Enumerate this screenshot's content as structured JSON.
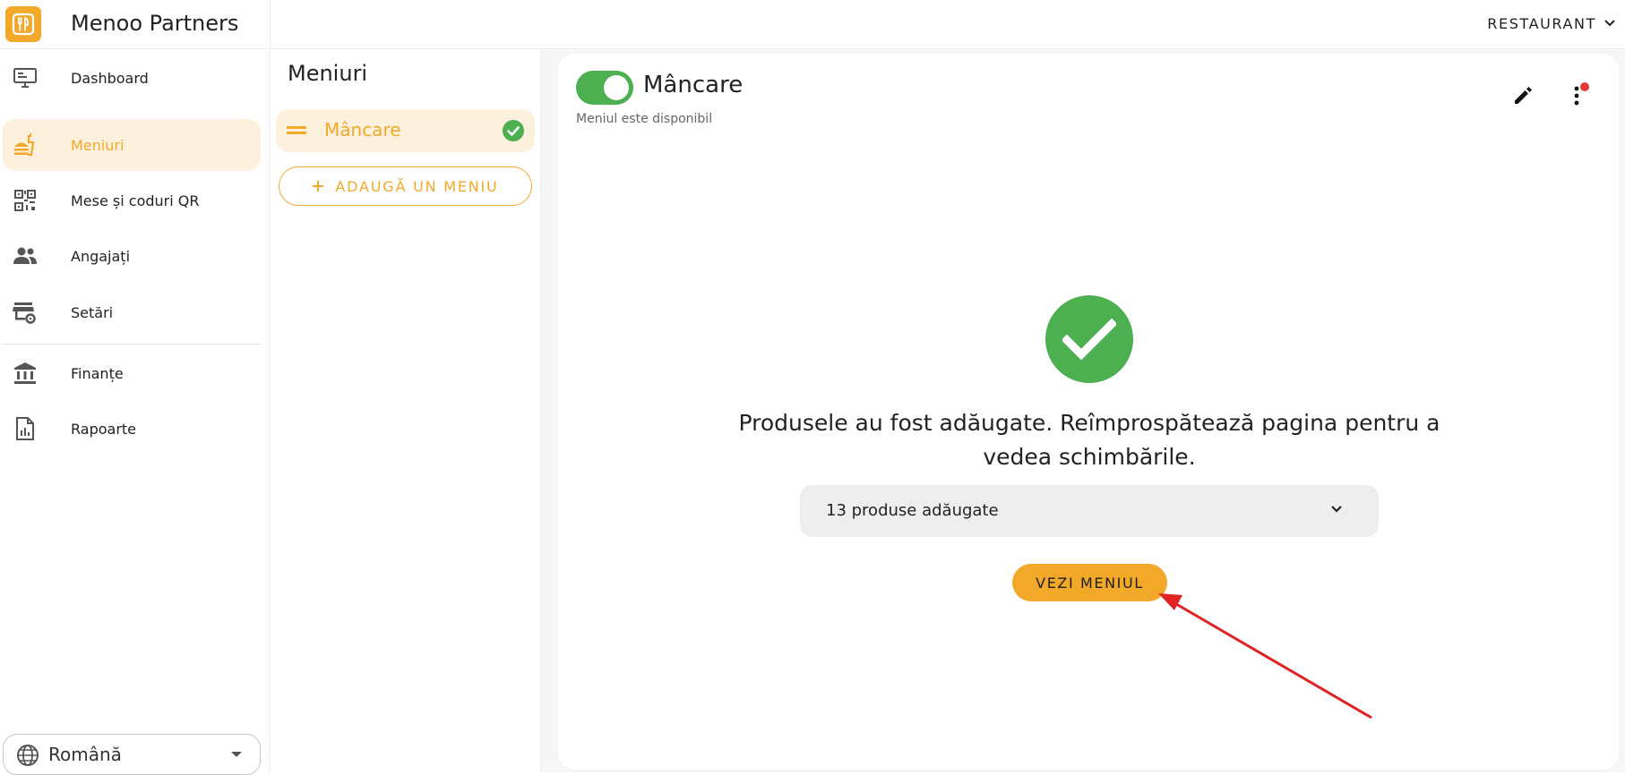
{
  "app": {
    "title": "Menoo Partners",
    "restaurant_label": "RESTAURANT",
    "accent_color": "#f2a929",
    "success_color": "#4caf50"
  },
  "sidebar": {
    "items": [
      {
        "label": "Dashboard",
        "icon": "monitor-icon",
        "active": false
      },
      {
        "label": "Meniuri",
        "icon": "food-menu-icon",
        "active": true
      },
      {
        "label": "Mese și coduri QR",
        "icon": "qr-code-icon",
        "active": false
      },
      {
        "label": "Angajați",
        "icon": "people-icon",
        "active": false
      },
      {
        "label": "Setări",
        "icon": "store-settings-icon",
        "active": false
      },
      {
        "label": "Finanțe",
        "icon": "bank-icon",
        "active": false
      },
      {
        "label": "Rapoarte",
        "icon": "report-icon",
        "active": false
      }
    ],
    "language": "Română"
  },
  "menus": {
    "title": "Meniuri",
    "items": [
      {
        "label": "Mâncare",
        "status": "check-circle-icon"
      }
    ],
    "add_label": "ADAUGĂ UN MENIU"
  },
  "main": {
    "menu_title": "Mâncare",
    "availability": "Meniul este disponibil",
    "toggle_on": true,
    "success_message": "Produsele au fost adăugate. Reîmprospătează pagina pentru a vedea schimbările.",
    "products_summary": "13 produse adăugate",
    "view_menu_label": "VEZI MENIUL"
  }
}
